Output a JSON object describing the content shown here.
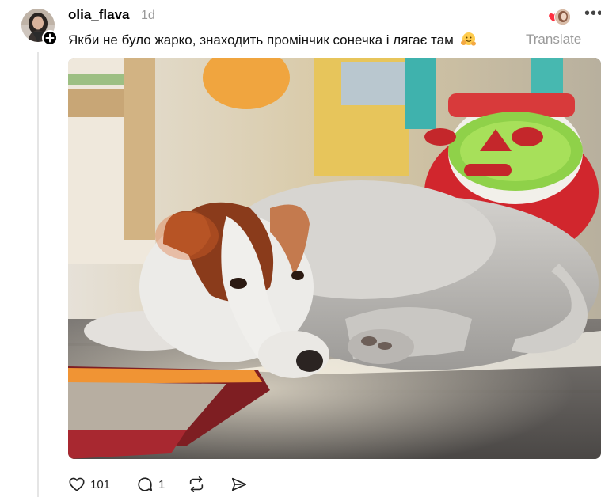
{
  "post": {
    "username": "olia_flava",
    "timestamp": "1d",
    "caption": "Якби не було жарко, знаходить промінчик сонечка і лягає там",
    "caption_emoji": "hugging-face-emoji",
    "translate_label": "Translate",
    "more_label": "•••",
    "follow_badge": "+"
  },
  "actions": {
    "likes": "101",
    "replies": "1"
  },
  "icons": {
    "like": "heart-icon",
    "reply": "comment-icon",
    "repost": "repost-icon",
    "share": "send-icon",
    "liked_heart": "heart-icon"
  },
  "colors": {
    "liked_heart": "#ff3040",
    "muted_text": "#999999",
    "text": "#101010"
  }
}
